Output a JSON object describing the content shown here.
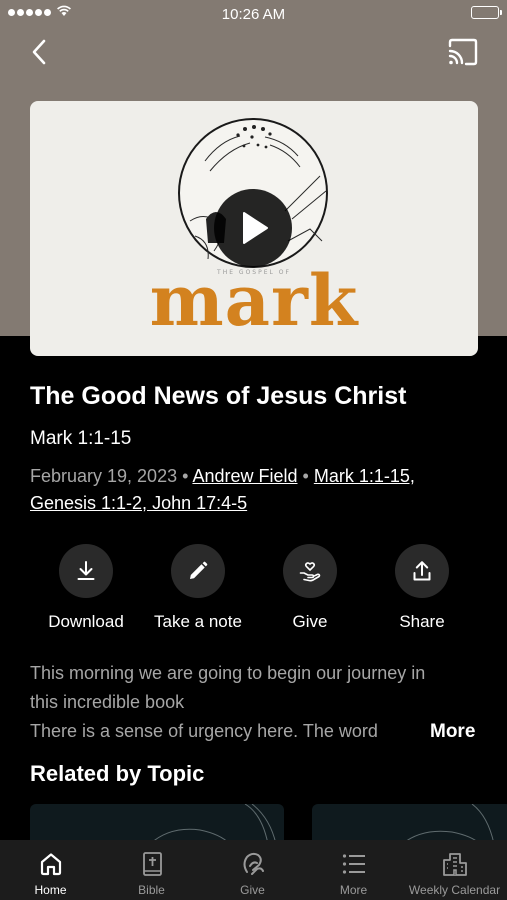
{
  "status_bar": {
    "time": "10:26 AM"
  },
  "video": {
    "series_small": "THE GOSPEL OF",
    "series_word": "mark"
  },
  "sermon": {
    "title": "The Good News of Jesus Christ",
    "subtitle": "Mark 1:1-15",
    "date": "February 19, 2023",
    "speaker": "Andrew Field",
    "scriptures_line1": "Mark 1:1-15,",
    "scriptures_line2": "Genesis 1:1-2, John 17:4-5",
    "separator": "•"
  },
  "actions": [
    {
      "label": "Download",
      "icon": "download-icon"
    },
    {
      "label": "Take a note",
      "icon": "pencil-icon"
    },
    {
      "label": "Give",
      "icon": "give-icon"
    },
    {
      "label": "Share",
      "icon": "share-icon"
    }
  ],
  "description": {
    "line1": "This morning we are going to begin our journey in",
    "line2": "this incredible book",
    "line3": "There is a sense of urgency here. The word",
    "more": "More"
  },
  "related": {
    "title": "Related by Topic"
  },
  "tabs": [
    {
      "label": "Home",
      "icon": "home-icon",
      "active": true
    },
    {
      "label": "Bible",
      "icon": "bible-icon"
    },
    {
      "label": "Give",
      "icon": "give-icon"
    },
    {
      "label": "More",
      "icon": "list-icon"
    },
    {
      "label": "Weekly Calendar",
      "icon": "building-icon"
    }
  ],
  "colors": {
    "hero_background": "#837a72",
    "accent_orange": "#d3821f",
    "tab_bar": "#1c1c1c",
    "muted_text": "#a6a6a6"
  }
}
